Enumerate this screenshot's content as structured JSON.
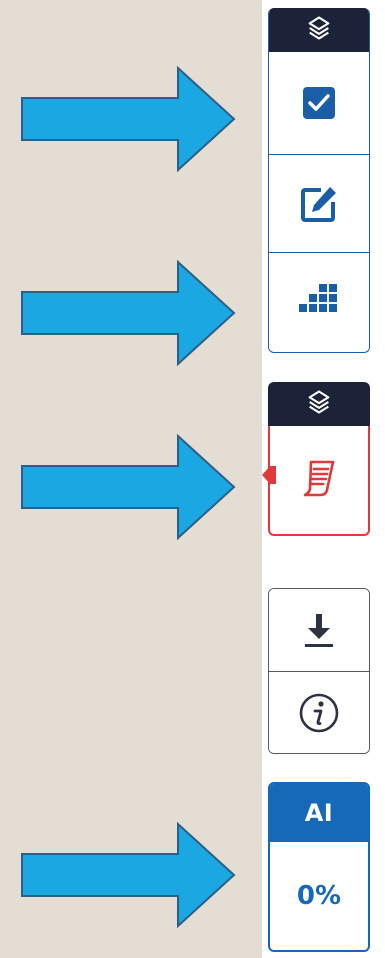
{
  "colors": {
    "background": "#e4ddd3",
    "arrow_fill": "#1aa7e2",
    "arrow_stroke": "#2c5f86",
    "panel_dark_header": "#1c2338",
    "primary_blue": "#1b5ea8",
    "note_red": "#e0383b",
    "neutral_gray": "#555b66",
    "ai_blue": "#1668b8"
  },
  "arrows": [
    {
      "name": "arrow-1",
      "points_to": "checkbox-tool"
    },
    {
      "name": "arrow-2",
      "points_to": "grid-tool"
    },
    {
      "name": "arrow-3",
      "points_to": "notes-tool"
    },
    {
      "name": "arrow-4",
      "points_to": "ai-score-panel"
    }
  ],
  "toolbar": {
    "review_panel": {
      "header_icon": "layers-icon",
      "tools": [
        {
          "icon": "checkbox-icon"
        },
        {
          "icon": "edit-icon"
        },
        {
          "icon": "grid-icon"
        }
      ]
    },
    "notes_panel": {
      "header_icon": "layers-icon",
      "tool_icon": "notes-icon"
    },
    "utility_panel": {
      "tools": [
        {
          "icon": "download-icon"
        },
        {
          "icon": "info-icon"
        }
      ]
    },
    "ai_panel": {
      "label": "AI",
      "score": "0%"
    }
  }
}
